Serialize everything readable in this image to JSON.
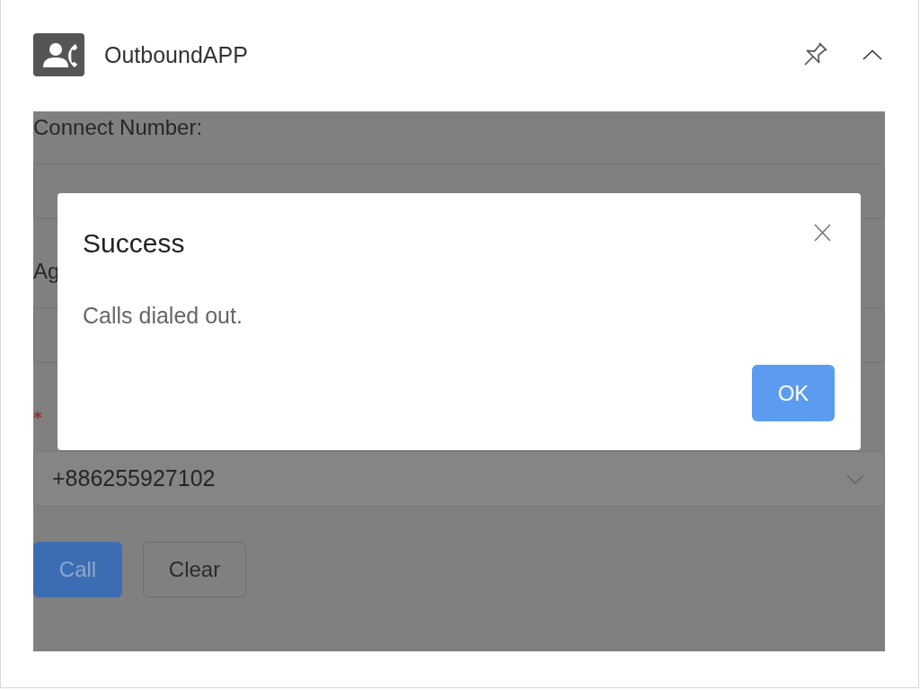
{
  "header": {
    "title": "OutboundAPP"
  },
  "form": {
    "fields": [
      {
        "kind": "input",
        "label": "Connect Number:",
        "required": false
      },
      {
        "kind": "input",
        "label": "Ag",
        "required": false
      },
      {
        "kind": "select",
        "required": true,
        "value": "+886255927102"
      }
    ],
    "buttons": [
      {
        "kind": "primary",
        "label": "Call"
      },
      {
        "kind": "default",
        "label": "Clear"
      }
    ]
  },
  "dialog": {
    "title": "Success",
    "message": "Calls dialed out.",
    "button": "OK"
  }
}
